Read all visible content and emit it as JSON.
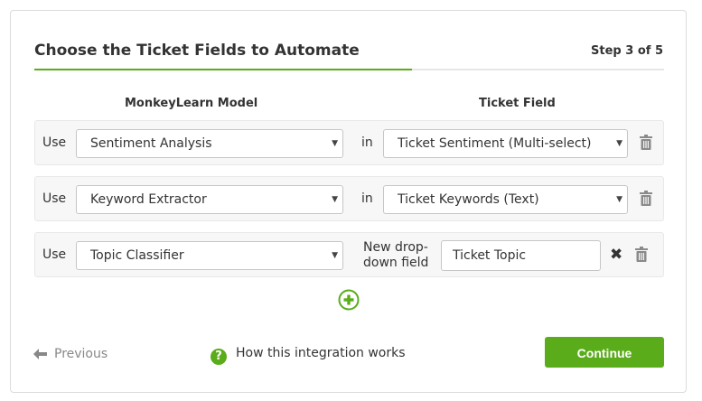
{
  "header": {
    "title": "Choose the Ticket Fields to Automate",
    "step": "Step 3 of 5",
    "progress_fraction": 0.6
  },
  "columns": {
    "model": "MonkeyLearn Model",
    "field": "Ticket Field"
  },
  "rows": [
    {
      "use_label": "Use",
      "model": "Sentiment Analysis",
      "in_label": "in",
      "field": "Ticket Sentiment (Multi-select)"
    },
    {
      "use_label": "Use",
      "model": "Keyword Extractor",
      "in_label": "in",
      "field": "Ticket Keywords (Text)"
    },
    {
      "use_label": "Use",
      "model": "Topic Classifier",
      "new_field_label": "New drop-down field",
      "new_field_value": "Ticket Topic"
    }
  ],
  "footer": {
    "previous": "Previous",
    "help": "How this integration works",
    "continue": "Continue"
  },
  "colors": {
    "accent": "#5aac1a"
  },
  "icons": {
    "dropdown": "caret-down-icon",
    "delete": "trash-icon",
    "clear": "close-icon",
    "add": "plus-circle-icon",
    "back": "arrow-left-icon",
    "help": "question-circle-icon"
  }
}
